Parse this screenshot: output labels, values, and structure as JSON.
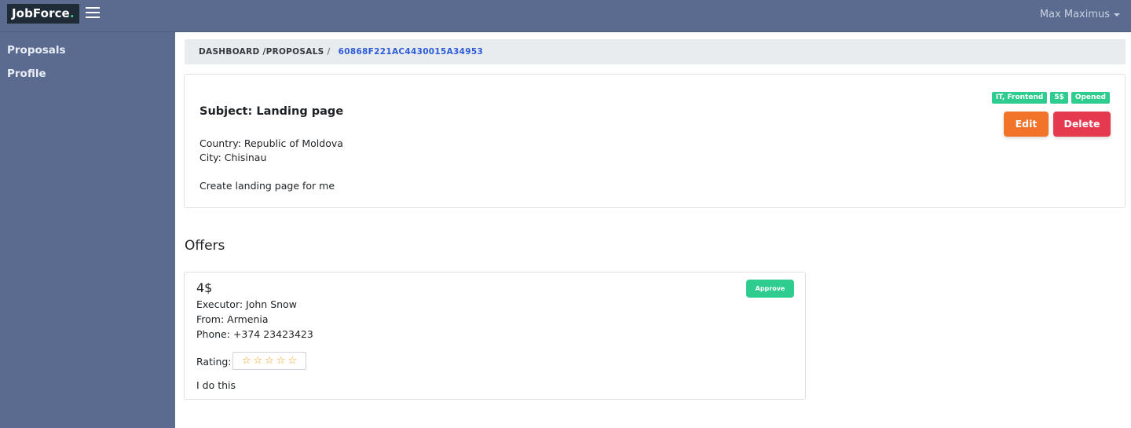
{
  "header": {
    "logo_text": "JobForce",
    "logo_dot": ".",
    "user_name": "Max Maximus"
  },
  "sidebar": {
    "items": [
      {
        "label": "Proposals"
      },
      {
        "label": "Profile"
      }
    ]
  },
  "breadcrumb": {
    "dashboard": "DASHBOARD",
    "proposals": "/PROPOSALS",
    "separator": "/",
    "current_id": "60868F221AC4430015A34953"
  },
  "proposal": {
    "subject": "Subject: Landing page",
    "country": "Country: Republic of Moldova",
    "city": "City: Chisinau",
    "description": "Create landing page for me",
    "tags": [
      "IT, Frontend",
      "5$",
      "Opened"
    ],
    "edit_label": "Edit",
    "delete_label": "Delete"
  },
  "offers": {
    "title": "Offers",
    "items": [
      {
        "price": "4$",
        "executor": "Executor: John Snow",
        "from": "From: Armenia",
        "phone": "Phone: +374 23423423",
        "rating_label": "Rating:",
        "rating_value": 0,
        "rating_max": 5,
        "description": "I do this",
        "approve_label": "Approve"
      }
    ]
  },
  "colors": {
    "nav_bg": "#5a6b8f",
    "accent_green": "#2ecc8e",
    "edit_orange": "#f2742a",
    "delete_red": "#e53950",
    "link_blue": "#2b5bd7"
  }
}
